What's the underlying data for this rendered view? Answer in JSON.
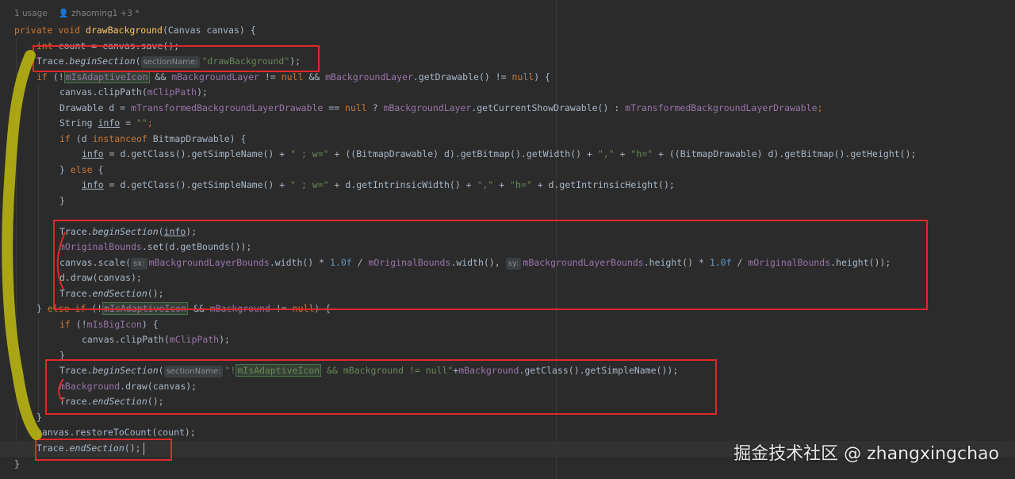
{
  "meta": {
    "usage": "1 usage",
    "author": "zhaoming1 +3 *"
  },
  "colors": {
    "background": "#2b2b2b",
    "keyword": "#cc7832",
    "method": "#ffc66d",
    "field": "#9876aa",
    "string": "#6a8759",
    "number": "#6897bb",
    "annotation_box": "#e0282a",
    "scribble": "#b5b012"
  },
  "code": {
    "l1": {
      "kw": "private void ",
      "fn": "drawBackground",
      "rest": "(Canvas canvas) {"
    },
    "l2": {
      "kw": "int ",
      "pre": "count = canvas.",
      "m": "save",
      "post": "();"
    },
    "l3": {
      "obj": "Trace.",
      "m": "beginSection",
      "open": "(",
      "hint": "sectionName:",
      "str": "\"drawBackground\"",
      "close": ");"
    },
    "l4": {
      "kw": "if ",
      "a": "(!",
      "fld1": "mIsAdaptiveIcon",
      "b": " && ",
      "fld2": "mBackgroundLayer",
      "c": " != ",
      "kw2": "null",
      "d": " && ",
      "fld3": "mBackgroundLayer",
      "e": ".getDrawable() != ",
      "kw3": "null",
      "f": ") {"
    },
    "l5": {
      "a": "canvas.clipPath(",
      "fld": "mClipPath",
      "b": ");"
    },
    "l6": {
      "a": "Drawable d = ",
      "fld1": "mTransformedBackgroundLayerDrawable",
      "b": " == ",
      "kw": "null",
      "c": " ? ",
      "fld2": "mBackgroundLayer",
      "d": ".getCurrentShowDrawable() : ",
      "fld3": "mTransformedBackgroundLayerDrawable",
      "e": ";"
    },
    "l7": {
      "a": "String ",
      "var": "info",
      "b": " = ",
      "str": "\"\"",
      "c": ";"
    },
    "l8": {
      "kw": "if ",
      "a": "(d ",
      "kw2": "instanceof",
      "b": " BitmapDrawable) {"
    },
    "l9": {
      "var": "info",
      "a": " = d.getClass().getSimpleName() + ",
      "s1": "\" ; w=\"",
      "b": " + ((BitmapDrawable) d).getBitmap().getWidth() + ",
      "s2": "\",\"",
      "c": " + ",
      "s3": "\"h=\"",
      "d": " + ((BitmapDrawable) d).getBitmap().getHeight();"
    },
    "l10": {
      "a": "} ",
      "kw": "else",
      "b": " {"
    },
    "l11": {
      "var": "info",
      "a": " = d.getClass().getSimpleName() + ",
      "s1": "\" ; w=\"",
      "b": " + d.getIntrinsicWidth() + ",
      "s2": "\",\"",
      "c": " + ",
      "s3": "\"h=\"",
      "d": " + d.getIntrinsicHeight();"
    },
    "l12": "}",
    "l14": {
      "obj": "Trace.",
      "m": "beginSection",
      "open": "(",
      "var": "info",
      "close": ");"
    },
    "l15": {
      "fld": "mOriginalBounds",
      "a": ".set(d.getBounds());"
    },
    "l16": {
      "a": "canvas.scale(",
      "h1": "sx:",
      "fld1": "mBackgroundLayerBounds",
      "b": ".width() * ",
      "n1": "1.0f",
      "c": " / ",
      "fld2": "mOriginalBounds",
      "d": ".width(), ",
      "h2": "sy:",
      "fld3": "mBackgroundLayerBounds",
      "e": ".height() * ",
      "n2": "1.0f",
      "f": " / ",
      "fld4": "mOriginalBounds",
      "g": ".height());"
    },
    "l17": {
      "a": "d.draw(canvas);"
    },
    "l18": {
      "obj": "Trace.",
      "m": "endSection",
      "close": "();"
    },
    "l19": {
      "a": "} ",
      "kw": "else if",
      "b": " (!",
      "fld1": "mIsAdaptiveIcon",
      "c": " && ",
      "fld2": "mBackground",
      "d": " != ",
      "kw2": "null",
      "e": ") {"
    },
    "l20": {
      "kw": "if ",
      "a": "(!",
      "fld": "mIsBigIcon",
      "b": ") {"
    },
    "l21": {
      "a": "canvas.clipPath(",
      "fld": "mClipPath",
      "b": ");"
    },
    "l22": "}",
    "l23": {
      "obj": "Trace.",
      "m": "beginSection",
      "open": "(",
      "hint": "sectionName:",
      "s1": "\"!",
      "hl": "mIsAdaptiveIcon",
      "s2": " && mBackground != null\"",
      "a": "+",
      "fld": "mBackground",
      "b": ".getClass().getSimpleName());"
    },
    "l24": {
      "fld": "mBackground",
      "a": ".draw(canvas);"
    },
    "l25": {
      "obj": "Trace.",
      "m": "endSection",
      "close": "();"
    },
    "l26": "}",
    "l27": {
      "a": "canvas.restoreToCount(count);"
    },
    "l28": {
      "obj": "Trace.",
      "m": "endSection",
      "close": "();"
    },
    "l29": "}"
  },
  "watermark": "掘金技术社区 @ zhangxingchao"
}
